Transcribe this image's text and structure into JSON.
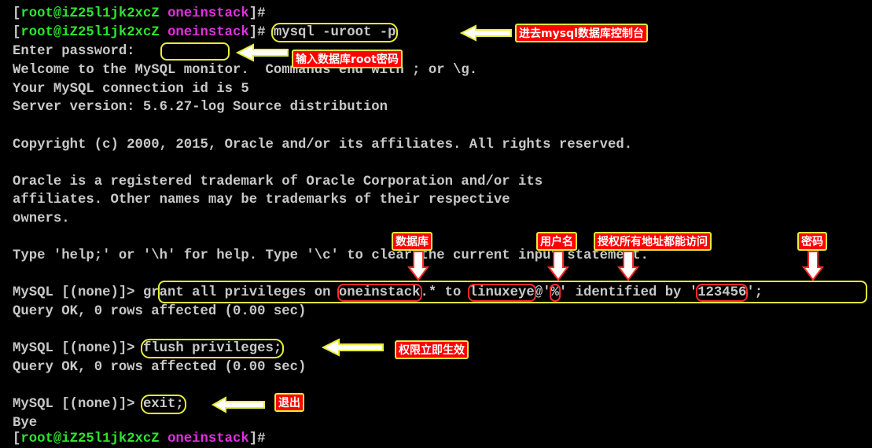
{
  "terminal": {
    "prompt": {
      "open": "[",
      "user_host": "root@iZ25l1jk2xcZ",
      "dir": "oneinstack",
      "close": "]#"
    },
    "cmd_mysql": "mysql -uroot -p",
    "enter_password": "Enter password:",
    "welcome_a": "Welcome to the MySQL monitor.  ",
    "welcome_b": "Commands end with ; or \\g.",
    "connection_id": "Your MySQL connection id is 5",
    "server_version": "Server version: 5.6.27-log Source distribution",
    "copyright": "Copyright (c) 2000, 2015, Oracle and/or its affiliates. All rights reserved.",
    "oracle_1": "Oracle is a registered trademark of Oracle Corporation and/or its",
    "oracle_2": "affiliates. Other names may be trademarks of their respective",
    "oracle_3": "owners.",
    "help_a": "Type 'help;' or '\\h' for help. Type '\\c' to ",
    "help_b": "clear the current input statement.",
    "mysql_prompt": "MySQL [(none)]> ",
    "grant": {
      "p1": "grant all privileges on ",
      "db": "oneinstack",
      "p2": ".* to ",
      "user": "linuxeye",
      "at": "@'",
      "host": "%",
      "p3": "' identified by '",
      "pwd": "123456",
      "end": "';"
    },
    "query_ok": "Query OK, 0 rows affected (0.00 sec)",
    "flush": "flush privileges;",
    "exit": "exit;",
    "bye": "Bye"
  },
  "annotations": {
    "enter_console": "进去mysql数据库控制台",
    "enter_root_password": "输入数据库root密码",
    "database": "数据库",
    "username": "用户名",
    "all_hosts": "授权所有地址都能访问",
    "password": "密码",
    "effective_now": "权限立即生效",
    "quit": "退出"
  },
  "colors": {
    "background": "#000000",
    "text": "#c8c8c8",
    "user": "#2ee32e",
    "dir": "#e02fe0",
    "highlight": "#e8ee3a",
    "annotation_bg": "#ff0000"
  }
}
